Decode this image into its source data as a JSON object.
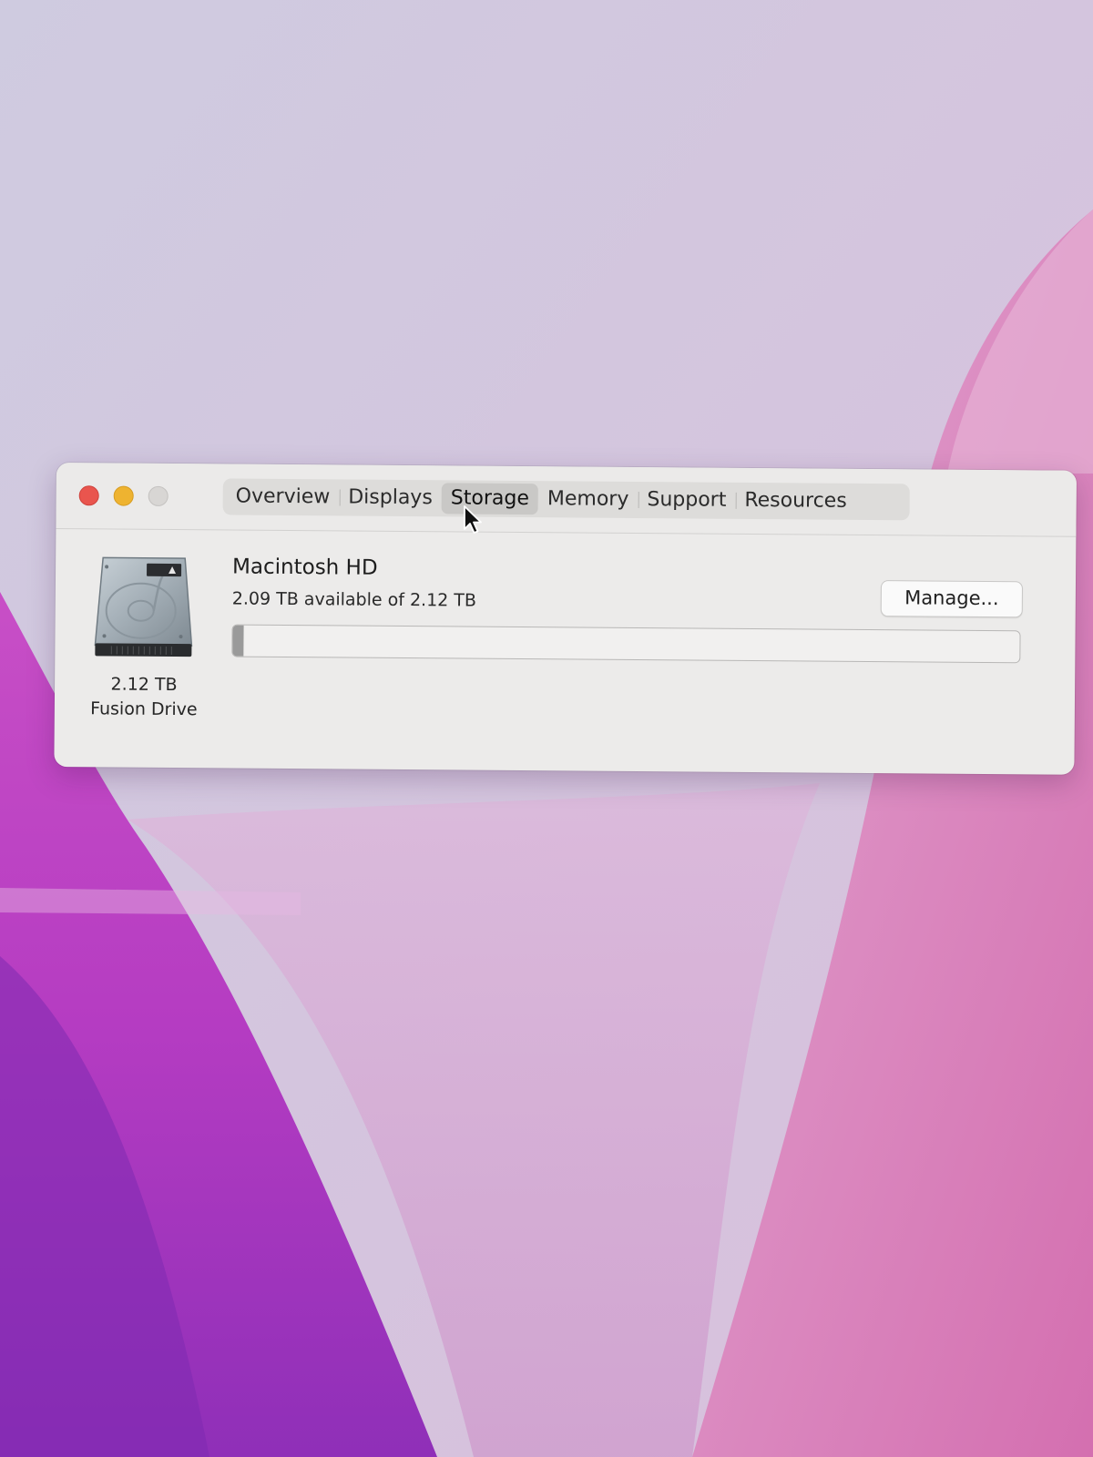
{
  "window": {
    "traffic_lights": {
      "close_color": "#e9554e",
      "minimize_color": "#eeb330",
      "zoom_color": "#d8d6d4"
    },
    "tabs": [
      {
        "label": "Overview",
        "active": false
      },
      {
        "label": "Displays",
        "active": false
      },
      {
        "label": "Storage",
        "active": true
      },
      {
        "label": "Memory",
        "active": false
      },
      {
        "label": "Support",
        "active": false
      },
      {
        "label": "Resources",
        "active": false
      }
    ]
  },
  "storage": {
    "drive": {
      "icon": "hard-drive-icon",
      "capacity": "2.12 TB",
      "type": "Fusion Drive"
    },
    "volume": {
      "name": "Macintosh HD",
      "availability": "2.09 TB available of 2.12 TB",
      "used_fraction": 0.014
    },
    "manage_label": "Manage..."
  },
  "cursor": {
    "icon": "arrow-cursor-icon"
  }
}
